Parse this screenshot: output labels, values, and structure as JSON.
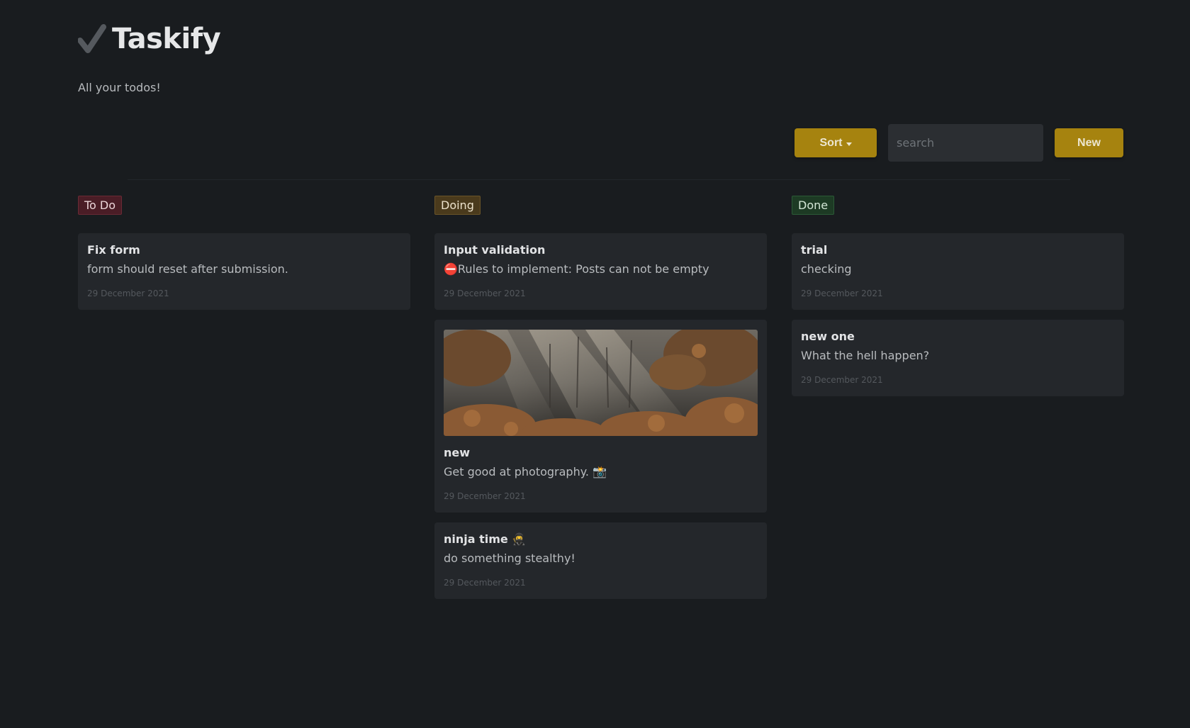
{
  "app": {
    "title": "Taskify",
    "subtitle": "All your todos!"
  },
  "toolbar": {
    "sort_label": "Sort",
    "search_placeholder": "search",
    "new_label": "New",
    "accent_color": "#a6830f"
  },
  "columns": [
    {
      "label": "To Do",
      "color": "#4a1d26",
      "cards": [
        {
          "title": "Fix form",
          "description": "form should reset after submission.",
          "date": "29 December 2021"
        }
      ]
    },
    {
      "label": "Doing",
      "color": "#4a3a1c",
      "cards": [
        {
          "title": "Input validation",
          "description": "⛔Rules to implement: Posts can not be empty",
          "date": "29 December 2021"
        },
        {
          "title": "new",
          "description": "Get good at photography. 📸",
          "date": "29 December 2021",
          "image": "misty-forest-photo"
        },
        {
          "title": "ninja time 🥷",
          "description": "do something stealthy!",
          "date": "29 December 2021"
        }
      ]
    },
    {
      "label": "Done",
      "color": "#1d3a24",
      "cards": [
        {
          "title": "trial",
          "description": "checking",
          "date": "29 December 2021"
        },
        {
          "title": "new one",
          "description": "What the hell happen?",
          "date": "29 December 2021"
        }
      ]
    }
  ]
}
